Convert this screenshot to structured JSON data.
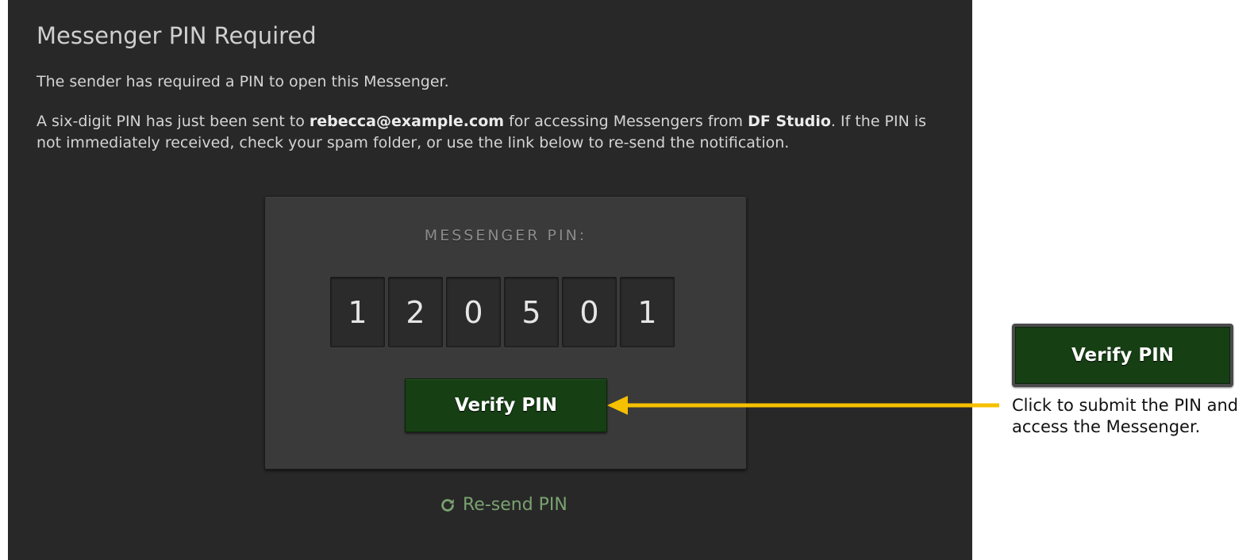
{
  "page": {
    "title": "Messenger PIN Required",
    "intro": "The sender has required a PIN to open this Messenger.",
    "details": {
      "part1": "A six-digit PIN has just been sent to ",
      "email": "rebecca@example.com",
      "part2": " for accessing Messengers from ",
      "studio": "DF Studio",
      "part3": ". If the PIN is not immediately received, check your spam folder, or use the link below to re-send the notification."
    }
  },
  "pin_form": {
    "label": "MESSENGER PIN:",
    "digits": [
      "1",
      "2",
      "0",
      "5",
      "0",
      "1"
    ],
    "verify_label": "Verify PIN",
    "resend_label": "Re-send PIN",
    "resend_icon": "refresh-icon"
  },
  "annotation": {
    "button_label": "Verify PIN",
    "caption": "Click to submit the PIN and access the Messenger.",
    "arrow_color": "#f5c000"
  },
  "colors": {
    "background": "#282828",
    "card": "#3a3a3a",
    "button": "#163f14",
    "link": "#7aa270"
  }
}
